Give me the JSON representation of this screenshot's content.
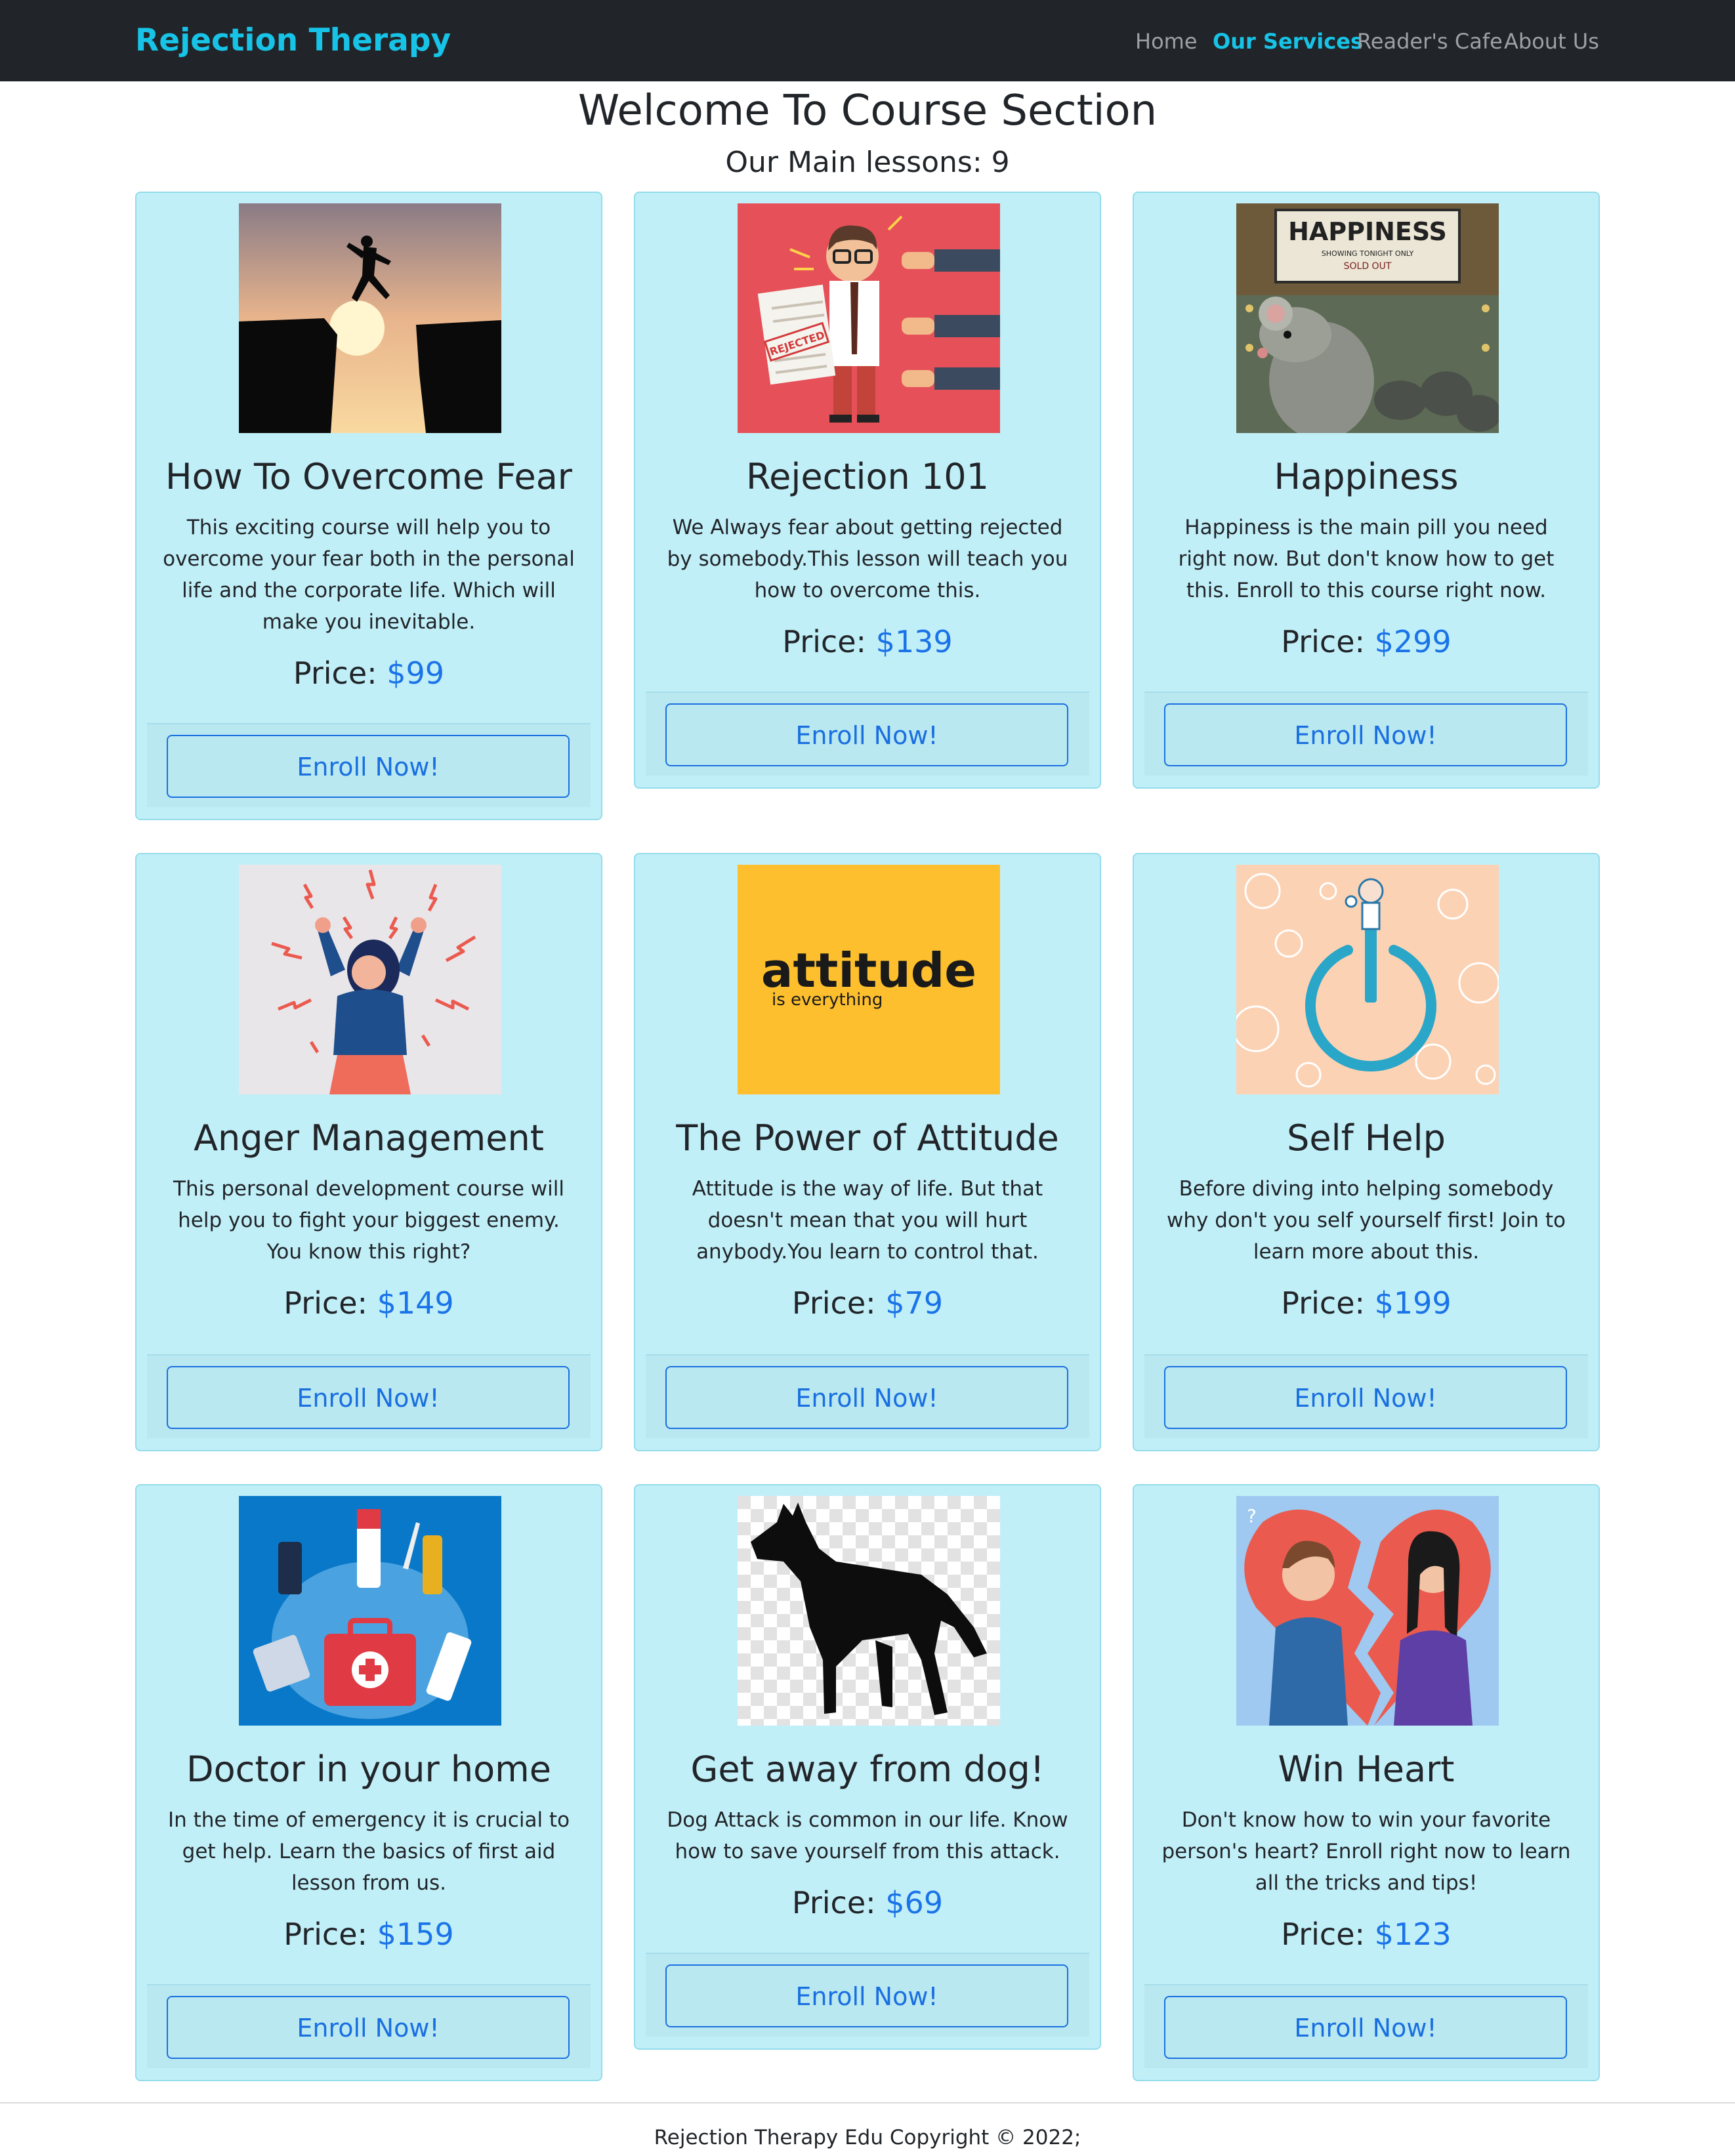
{
  "navbar": {
    "brand": "Rejection Therapy",
    "links": [
      {
        "label": "Home",
        "active": false
      },
      {
        "label": "Our Services",
        "active": true
      },
      {
        "label": "Reader's Cafe",
        "active": false
      },
      {
        "label": "About Us",
        "active": false
      }
    ]
  },
  "main": {
    "title": "Welcome To Course Section",
    "subtitle": "Our Main lessons: 9",
    "price_label": "Price: ",
    "enroll_label": "Enroll Now!",
    "courses": [
      {
        "title": "How To Overcome Fear",
        "description": "This exciting course will help you to overcome your fear both in the personal life and the corporate life. Which will make you inevitable.",
        "price": "$99",
        "image": "cliff-jump-silhouette"
      },
      {
        "title": "Rejection 101",
        "description": "We Always fear about getting rejected by somebody.This lesson will teach you how to overcome this.",
        "price": "$139",
        "image": "rejected-man-thumbs-down"
      },
      {
        "title": "Happiness",
        "description": "Happiness is the main pill you need right now. But don't know how to get this. Enroll to this course right now.",
        "price": "$299",
        "image": "happiness-theater-rat"
      },
      {
        "title": "Anger Management",
        "description": "This personal development course will help you to fight your biggest enemy. You know this right?",
        "price": "$149",
        "image": "angry-woman"
      },
      {
        "title": "The Power of Attitude",
        "description": "Attitude is the way of life. But that doesn't mean that you will hurt anybody.You learn to control that.",
        "price": "$79",
        "image": "attitude-is-everything"
      },
      {
        "title": "Self Help",
        "description": "Before diving into helping somebody why don't you self yourself first! Join to learn more about this.",
        "price": "$199",
        "image": "power-symbol-person"
      },
      {
        "title": "Doctor in your home",
        "description": "In the time of emergency it is crucial to get help. Learn the basics of first aid lesson from us.",
        "price": "$159",
        "image": "first-aid-kit"
      },
      {
        "title": "Get away from dog!",
        "description": "Dog Attack is common in our life. Know how to save yourself from this attack.",
        "price": "$69",
        "image": "german-shepherd-dog"
      },
      {
        "title": "Win Heart",
        "description": "Don't know how to win your favorite person's heart? Enroll right now to learn all the tricks and tips!",
        "price": "$123",
        "image": "broken-heart-couple"
      }
    ],
    "attitude_image_text": {
      "word": "attitude",
      "tagline": "is everything"
    },
    "happiness_image_text": {
      "marquee": "HAPPINESS",
      "line1": "SHOWING TONIGHT ONLY",
      "line2": "SOLD OUT"
    },
    "rejected_stamp": "REJECTED"
  },
  "footer": {
    "copyright": "Rejection Therapy Edu Copyright © 2022;"
  },
  "colors": {
    "navbar_bg": "#212529",
    "brand": "#17c3e6",
    "card_bg": "#c1eff8",
    "price_accent": "#1a73e8"
  }
}
